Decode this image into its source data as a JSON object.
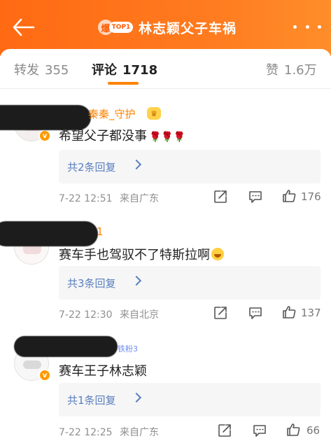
{
  "header": {
    "title": "林志颖父子车祸",
    "hot_flame": "爆",
    "hot_tag": "TOP1"
  },
  "tabs": [
    {
      "label": "转发",
      "count": "355"
    },
    {
      "label": "评论",
      "count": "1718"
    },
    {
      "label": "赞",
      "count": "1.6万"
    }
  ],
  "comments": [
    {
      "username": "秦秦_守护",
      "text": "希望父子都没事",
      "emoji": "🌹🌹🌹",
      "reply": "共2条回复",
      "time": "7-22 12:51",
      "source": "来自广东",
      "likes": "176"
    },
    {
      "username": "1",
      "text": "赛车手也驾驭不了特斯拉啊",
      "reply": "共3条回复",
      "time": "7-22 12:30",
      "source": "来自北京",
      "likes": "137"
    },
    {
      "badge": "铁粉3",
      "text": "赛车王子林志颖",
      "reply": "共1条回复",
      "time": "7-22 12:25",
      "source": "来自广东",
      "likes": "66"
    }
  ],
  "colors": {
    "header": "#ff6a13",
    "accent": "#ff8200",
    "link": "#5a7fbf"
  }
}
